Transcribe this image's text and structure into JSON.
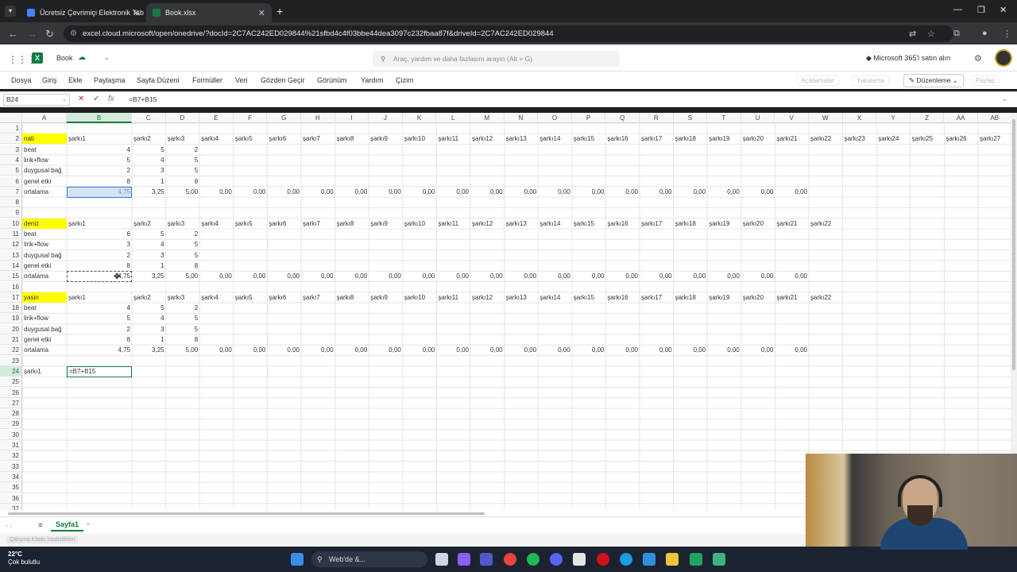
{
  "browser": {
    "tabs": [
      {
        "title": "Ücretsiz Çevrimiçi Elektronik Tab",
        "color": "#4285f4"
      },
      {
        "title": "Book.xlsx",
        "color": "#107c41"
      }
    ],
    "new_tab": "+",
    "url": "excel.cloud.microsoft/open/onedrive/?docId=2C7AC242ED029844%21sfbd4c4f03bbe44dea3097c232fbaa87f&driveId=2C7AC242ED029844"
  },
  "excel": {
    "book_name": "Book",
    "search_placeholder": "Araç, yardım ve daha fazlasını arayın (Alt + G)",
    "buy_label": "Microsoft 365'i satın alın",
    "ribbon_tabs": [
      "Dosya",
      "Giriş",
      "Ekle",
      "Paylaşma",
      "Sayfa Düzeni",
      "Formüller",
      "Veri",
      "Gözden Geçir",
      "Görünüm",
      "Yardım",
      "Çizim"
    ],
    "ribbon_right": [
      "Açıklamalar",
      "Yakalama",
      "Düzenleme",
      "Paylaş"
    ],
    "name_box": "B24",
    "formula": "=B7+B15",
    "fx": "fx",
    "columns": [
      "A",
      "B",
      "C",
      "D",
      "E",
      "F",
      "G",
      "H",
      "I",
      "J",
      "K",
      "L",
      "M",
      "N",
      "O",
      "P",
      "Q",
      "R",
      "S",
      "T",
      "U",
      "V",
      "W",
      "X",
      "Y",
      "Z",
      "AA",
      "AB"
    ],
    "rows": [
      "1",
      "2",
      "3",
      "4",
      "5",
      "6",
      "7",
      "8",
      "9",
      "10",
      "11",
      "12",
      "13",
      "14",
      "15",
      "16",
      "17",
      "18",
      "19",
      "20",
      "21",
      "22",
      "23",
      "24",
      "25",
      "26",
      "27",
      "28",
      "29",
      "30",
      "31",
      "32",
      "33",
      "34",
      "35",
      "36",
      "37"
    ],
    "sheet_tab": "Sayfa1",
    "status": "Çalışma Kitabı İstatistikleri",
    "editing_value": "=B7+B15",
    "blocks": [
      {
        "name": "nati",
        "header_row": 2
      },
      {
        "name": "deniz",
        "header_row": 10
      },
      {
        "name": "yasin",
        "header_row": 17
      }
    ],
    "row_labels": [
      "beat",
      "lirik+flow",
      "duygusal bağ",
      "genel etki",
      "ortalama"
    ],
    "song_headers": [
      "şarkı1",
      "şarkı2",
      "şarkı3",
      "şarkı4",
      "şarkı5",
      "şarkı6",
      "şarkı7",
      "şarkı8",
      "şarkı9",
      "şarkı10",
      "şarkı11",
      "şarkı12",
      "şarkı13",
      "şarkı14",
      "şarkı15",
      "şarkı16",
      "şarkı17",
      "şarkı18",
      "şarkı19",
      "şarkı20",
      "şarkı21",
      "şarkı22",
      "şarkı23",
      "şarkı24",
      "şarkı25",
      "şarkı26",
      "şarkı27"
    ],
    "scores": {
      "nati": [
        [
          4,
          5,
          2
        ],
        [
          5,
          4,
          5
        ],
        [
          2,
          3,
          5
        ],
        [
          8,
          1,
          8
        ]
      ],
      "deniz": [
        [
          6,
          5,
          2
        ],
        [
          3,
          4,
          5
        ],
        [
          2,
          3,
          5
        ],
        [
          8,
          1,
          8
        ]
      ],
      "yasin": [
        [
          4,
          5,
          2
        ],
        [
          5,
          4,
          5
        ],
        [
          2,
          3,
          5
        ],
        [
          8,
          1,
          8
        ]
      ]
    },
    "averages": [
      "4,75",
      "3,25",
      "5,00",
      "0,00",
      "0,00",
      "0,00",
      "0,00",
      "0,00",
      "0,00",
      "0,00",
      "0,00",
      "0,00",
      "0,00",
      "0,00",
      "0,00",
      "0,00",
      "0,00",
      "0,00",
      "0,00",
      "0,00",
      "0,00"
    ],
    "row24_label": "şarkı1"
  },
  "taskbar": {
    "temp": "22°C",
    "weather": "Çok bulutlu",
    "search": "Web'de &..."
  }
}
